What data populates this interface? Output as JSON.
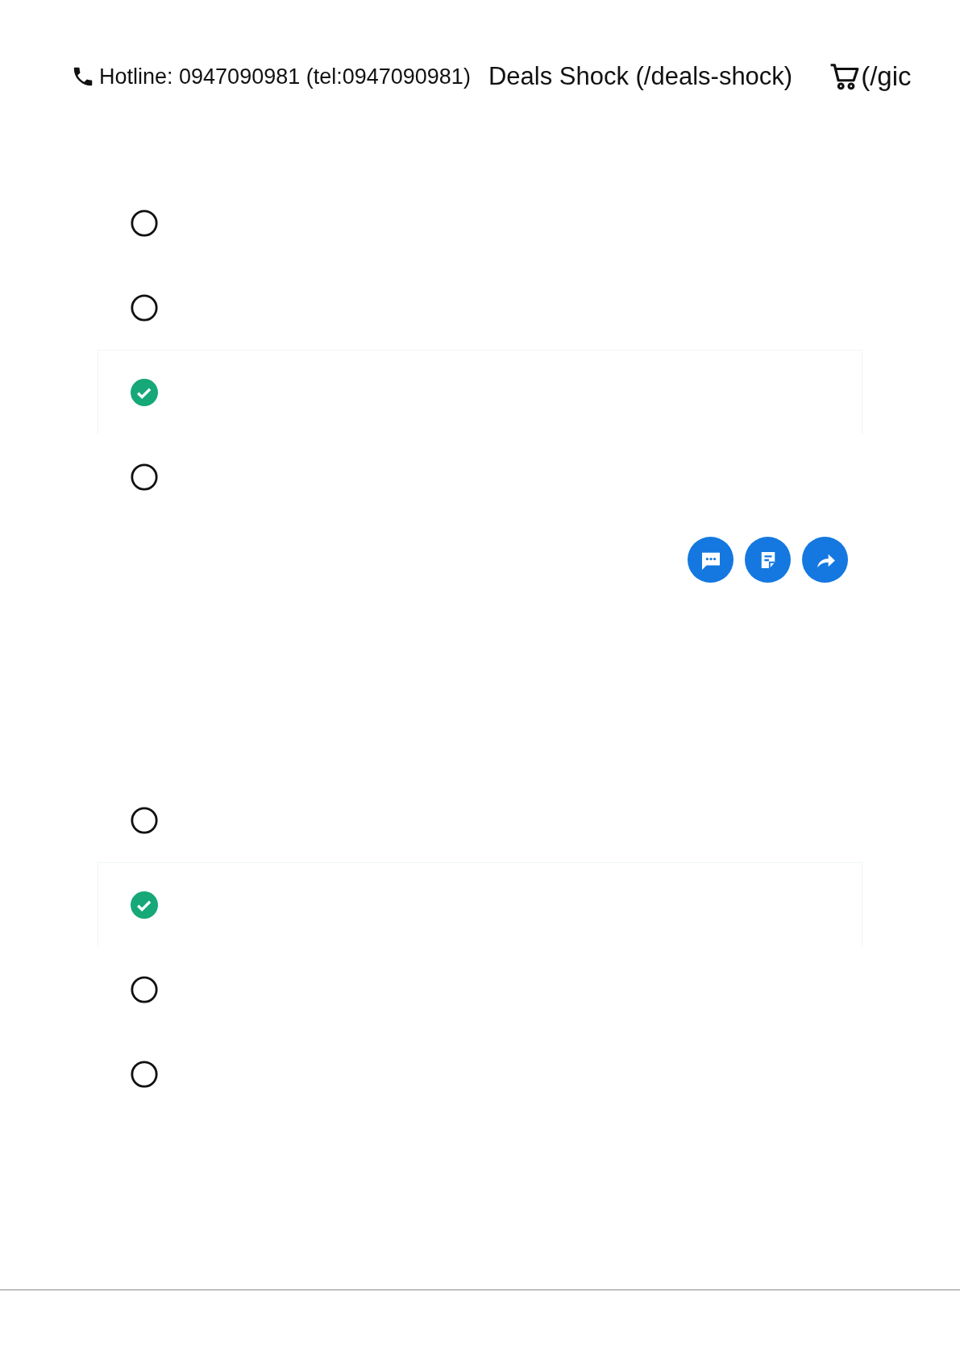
{
  "header": {
    "hotline": "Hotline: 0947090981 (tel:0947090981)",
    "deals_link": "Deals Shock (/deals-shock)",
    "cart_link": "(/gic"
  },
  "question_1": {
    "options": [
      {
        "selected": false
      },
      {
        "selected": false
      },
      {
        "selected": true
      },
      {
        "selected": false
      }
    ]
  },
  "actions": [
    {
      "kind": "comment"
    },
    {
      "kind": "note"
    },
    {
      "kind": "share"
    }
  ],
  "question_2": {
    "options": [
      {
        "selected": false
      },
      {
        "selected": true
      },
      {
        "selected": false
      },
      {
        "selected": false
      }
    ]
  }
}
